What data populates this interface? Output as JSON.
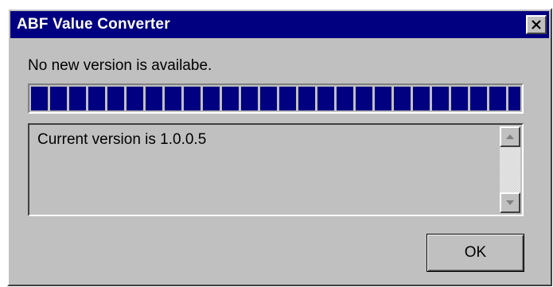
{
  "window": {
    "title": "ABF Value Converter",
    "close_icon": "close-icon"
  },
  "status": {
    "message": "No new version is availabe."
  },
  "progress": {
    "value_percent": 100,
    "color": "#000080"
  },
  "details": {
    "text": "Current version is 1.0.0.5",
    "scroll_up_icon": "scroll-up-arrow-icon",
    "scroll_down_icon": "scroll-down-arrow-icon"
  },
  "buttons": {
    "ok_label": "OK"
  },
  "colors": {
    "titlebar": "#000080",
    "face": "#c0c0c0"
  }
}
